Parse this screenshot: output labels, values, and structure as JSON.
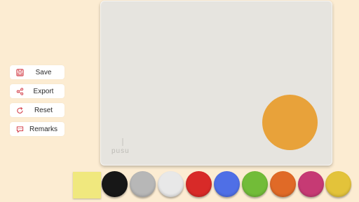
{
  "menu": {
    "items": [
      {
        "label": "Save",
        "icon": "save-icon"
      },
      {
        "label": "Export",
        "icon": "share-icon"
      },
      {
        "label": "Reset",
        "icon": "reset-icon"
      },
      {
        "label": "Remarks",
        "icon": "comment-icon"
      }
    ],
    "icon_color": "#d3404a"
  },
  "board": {
    "color": "#e6e4df",
    "brand": "pusu",
    "placed_dot_color": "#e8a23a"
  },
  "palette": {
    "sticky_note_color": "#f0e87e",
    "colors": [
      "#171717",
      "#b7b7b7",
      "#e8e8e8",
      "#d82a28",
      "#4f6fe6",
      "#72bc38",
      "#e06a27",
      "#c63a74",
      "#e3c33a"
    ]
  }
}
